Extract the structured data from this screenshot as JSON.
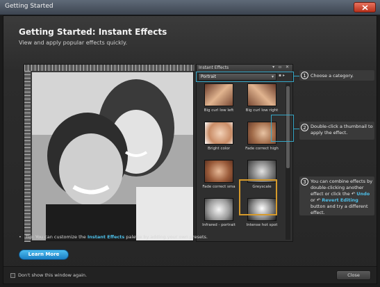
{
  "window": {
    "title": "Getting Started"
  },
  "header": {
    "title": "Getting Started: Instant Effects",
    "subtitle": "View and apply popular effects quickly."
  },
  "palette": {
    "title": "Instant Effects",
    "category": "Portrait",
    "thumbnails": [
      {
        "label": "Big curl low left"
      },
      {
        "label": "Big curl low right"
      },
      {
        "label": "Bright color"
      },
      {
        "label": "Fade correct high"
      },
      {
        "label": "Fade correct sma"
      },
      {
        "label": "Greyscale"
      },
      {
        "label": "Infrared - portrait"
      },
      {
        "label": "Intense hot spot"
      }
    ]
  },
  "callouts": [
    {
      "num": "1",
      "text": "Choose a category."
    },
    {
      "num": "2",
      "text": "Double-click a thumbnail to apply the effect."
    },
    {
      "num": "3",
      "text_a": "You can combine effects by double-clicking another effect or click the",
      "undo": "Undo",
      "or": "or",
      "revert": "Revert Editing",
      "text_b": "button and try a different effect."
    }
  ],
  "tip": {
    "prefix": "Tip: You can customize the",
    "link": "Instant Effects",
    "suffix": "palette by adding your own presets."
  },
  "buttons": {
    "learn_more": "Learn More",
    "close": "Close"
  },
  "footer": {
    "checkbox_label": "Don't show this window again."
  }
}
